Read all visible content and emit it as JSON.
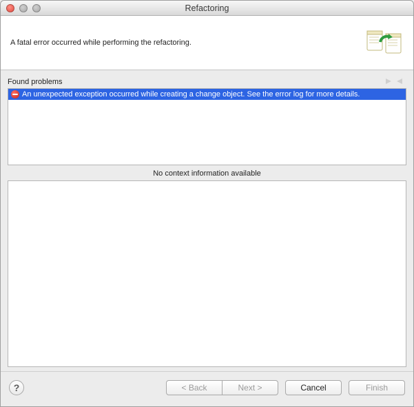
{
  "window": {
    "title": "Refactoring"
  },
  "banner": {
    "message": "A fatal error occurred while performing the refactoring."
  },
  "problems": {
    "heading": "Found problems",
    "items": [
      {
        "text": "An unexpected exception occurred while creating a change object. See the error log for more details.",
        "severity": "error",
        "selected": true
      }
    ]
  },
  "context": {
    "heading": "No context information available"
  },
  "buttons": {
    "back": {
      "label": "< Back",
      "enabled": false
    },
    "next": {
      "label": "Next >",
      "enabled": false
    },
    "cancel": {
      "label": "Cancel",
      "enabled": true
    },
    "finish": {
      "label": "Finish",
      "enabled": false
    }
  }
}
